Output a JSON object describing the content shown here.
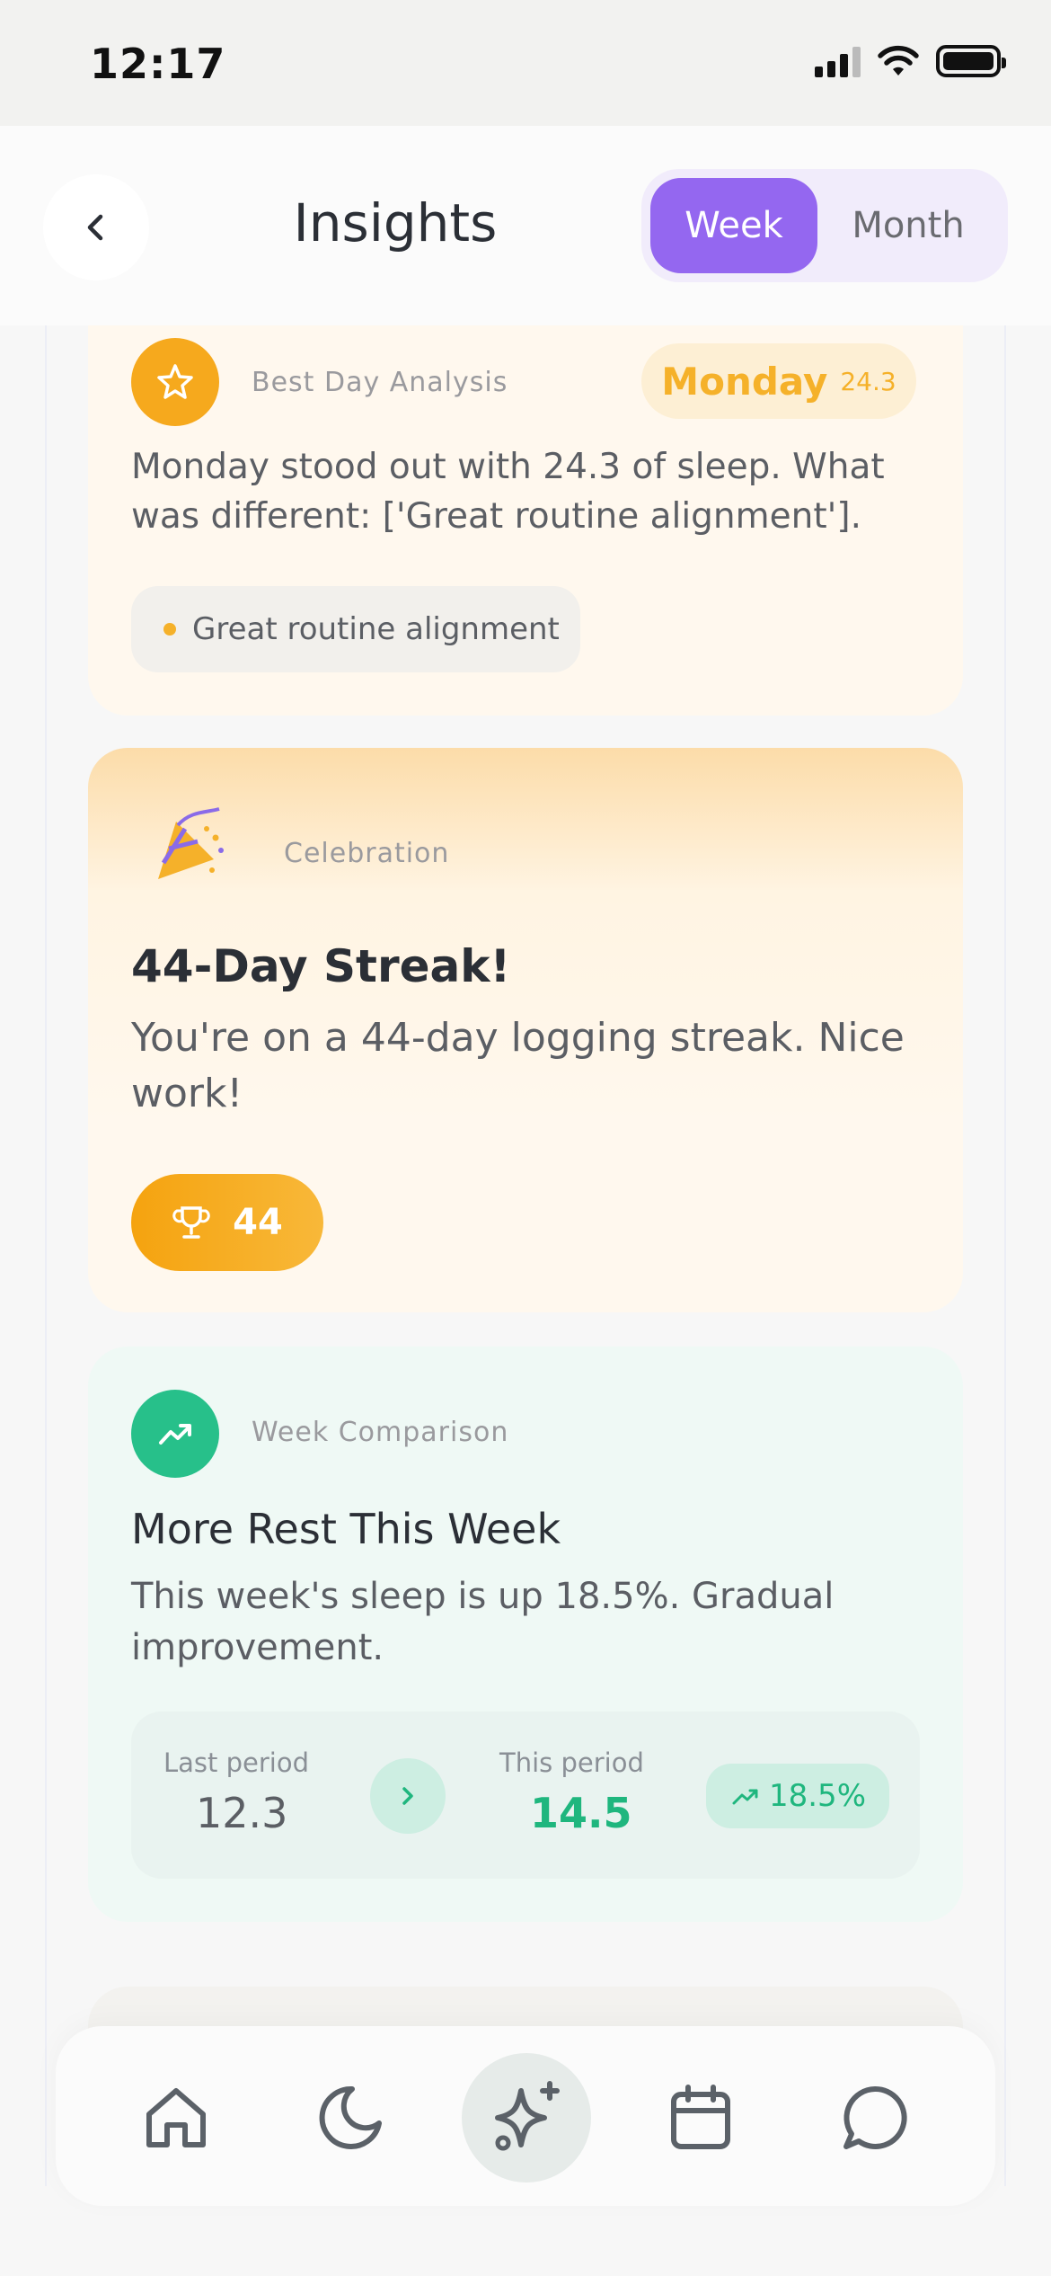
{
  "status_bar": {
    "time": "12:17"
  },
  "header": {
    "title": "Insights",
    "toggle": {
      "week": "Week",
      "month": "Month",
      "selected": "Week"
    }
  },
  "best_day": {
    "label": "Best Day Analysis",
    "day": "Monday",
    "value": "24.3",
    "text": "Monday stood out with 24.3 of sleep. What was different: ['Great routine alignment'].",
    "tag": "Great routine alignment",
    "accent": "#f5b12a"
  },
  "celebration": {
    "label": "Celebration",
    "title": "44-Day Streak!",
    "text": "You're on a 44-day logging streak. Nice work!",
    "badge": "44"
  },
  "week_comparison": {
    "label": "Week Comparison",
    "title": "More Rest This Week",
    "text": "This week's sleep is up 18.5%. Gradual improvement.",
    "last_label": "Last period",
    "last_value": "12.3",
    "this_label": "This period",
    "this_value": "14.5",
    "change": "18.5%",
    "accent": "#1fb67e"
  },
  "nav": {
    "items": [
      "home-icon",
      "moon-icon",
      "sparkle-icon",
      "calendar-icon",
      "chat-icon"
    ],
    "active": "sparkle-icon"
  }
}
